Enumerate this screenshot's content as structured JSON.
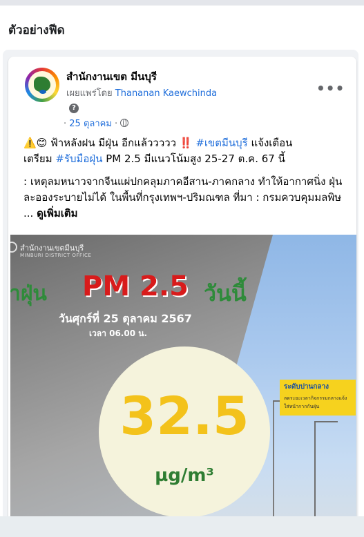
{
  "panel": {
    "title": "ตัวอย่างฟีด"
  },
  "post": {
    "page_name": "สำนักงานเขต มีนบุรี",
    "published_by_label": "เผยแพร่โดย",
    "published_by_name": "Thananan Kaewchinda",
    "date": "25 ตุลาคม",
    "audience_icon": "globe-icon",
    "help_glyph": "?",
    "more_glyph": "•••",
    "line1_prefix": "⚠️😊 ฟ้าหลังฝน มีฝุ่น อีกแล้ววววว ‼️ ",
    "line1_tag": "#เขตมีนบุรี",
    "line1_suffix": " แจ้งเตือน",
    "line2_prefix": "เตรียม ",
    "line2_tag": "#รับมือฝุ่น",
    "line2_suffix": " PM 2.5 มีแนวโน้มสูง 25-27 ต.ค. 67 นี้",
    "para2": ": เหตุลมหนาวจากจีนแผ่ปกคลุมภาคอีสาน-ภาคกลาง ทำให้อากาศนิ่ง ฝุ่นละอองระบายไม่ได้ ในพื้นที่กรุงเทพฯ-ปริมณฑล ที่มา : กรมควบคุมมลพิษ ... ",
    "see_more": "ดูเพิ่มเติม"
  },
  "media": {
    "watermark": "สำนักงานเขตมีนบุรี",
    "watermark_sub": "MINBURI DISTRICT OFFICE",
    "left_word": "าฝุ่น",
    "headline": "PM 2.5",
    "right_word": "วันนี้",
    "date_line": "วันศุกร์ที่ 25 ตุลาคม 2567",
    "time_line": "เวลา 06.00 น.",
    "value": "32.5",
    "unit": "µg/m³",
    "level_title": "ระดับปานกลาง",
    "level_items": [
      "ลดระยะเวลากิจกรรมกลางแจ้ง",
      "ใส่หน้ากากกันฝุ่น"
    ],
    "accent_color": "#d81b1b",
    "value_color": "#f3c21b"
  }
}
